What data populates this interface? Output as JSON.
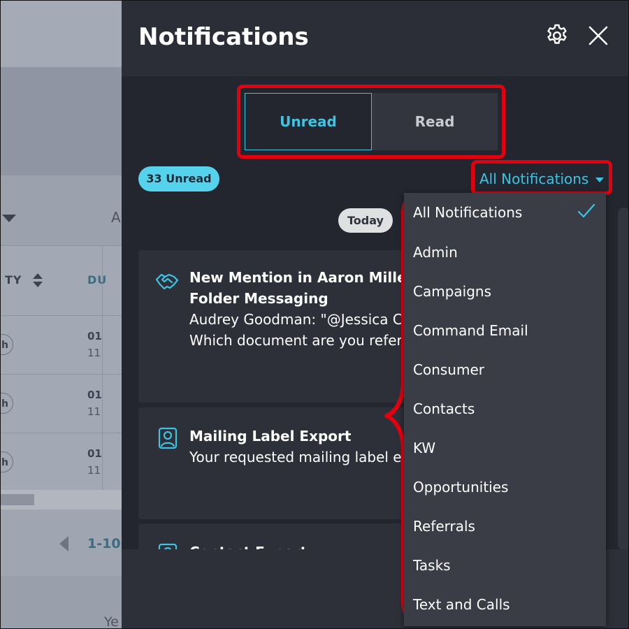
{
  "background": {
    "sort_header_left": "TY",
    "sort_header_right": "DU",
    "partial_letter": "A",
    "row_badge": "h",
    "rows": [
      {
        "line1": "01",
        "line2": "11"
      },
      {
        "line1": "01",
        "line2": "11"
      },
      {
        "line1": "01",
        "line2": "11"
      }
    ],
    "pagination": "1-10",
    "footer_text": "Ye"
  },
  "panel": {
    "title": "Notifications",
    "settings_icon": "gear-icon",
    "close_icon": "close-icon"
  },
  "tabs": {
    "unread": "Unread",
    "read": "Read",
    "active": "unread"
  },
  "unread_badge": "33 Unread",
  "filter": {
    "selected": "All Notifications"
  },
  "date_group": "Today",
  "notifications": [
    {
      "icon": "handshake-icon",
      "title_line1": "New Mention in Aaron Miller -",
      "title_line2": "Folder Messaging",
      "body_line1": "Audrey Goodman: \"@Jessica Co",
      "body_line2": "Which document are you referr"
    },
    {
      "icon": "contact-card-icon",
      "title_line1": "Mailing Label Export",
      "body_line1": "Your requested mailing label ex"
    },
    {
      "icon": "contact-card-icon",
      "title_line1": "Contact Export"
    }
  ],
  "dropdown": {
    "options": [
      "All Notifications",
      "Admin",
      "Campaigns",
      "Command Email",
      "Consumer",
      "Contacts",
      "KW",
      "Opportunities",
      "Referrals",
      "Tasks",
      "Text and Calls"
    ],
    "checked_index": 0
  },
  "colors": {
    "accent": "#3fc3e2",
    "highlight": "#e3000f",
    "panel_bg": "#23262e",
    "badge_bg": "#56d3ec"
  }
}
